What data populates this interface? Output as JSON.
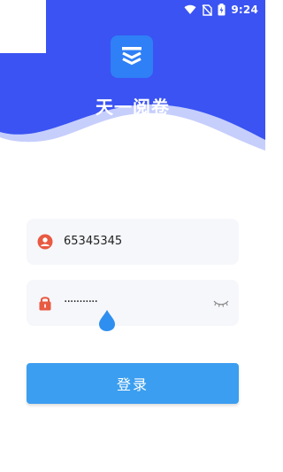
{
  "status_bar": {
    "time": "9:24",
    "icons": [
      "wifi-icon",
      "no-sim-icon",
      "battery-charging-icon"
    ]
  },
  "app": {
    "title": "天一阅卷",
    "logo_icon": "layers-logo-icon"
  },
  "login_form": {
    "username": {
      "value": "65345345",
      "icon": "user-icon"
    },
    "password": {
      "masked_value": "···········",
      "icon": "lock-icon",
      "toggle_icon": "eye-closed-icon"
    },
    "submit_label": "登录"
  },
  "colors": {
    "header_blue": "#3a53f2",
    "wave_light": "#c6cefc",
    "button_blue": "#3b9ef0",
    "user_icon": "#e85a42",
    "lock_icon": "#e85a42"
  }
}
